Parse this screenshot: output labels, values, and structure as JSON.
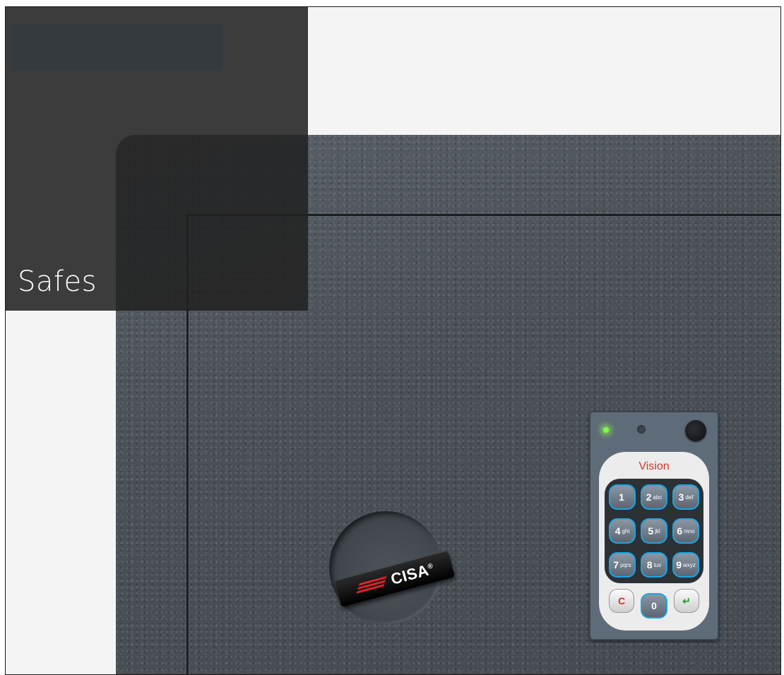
{
  "page": {
    "title": "Safes"
  },
  "handle": {
    "brand": "CISA",
    "registered_mark": "®",
    "logo_color": "#d8242a"
  },
  "keypad": {
    "brand": "Vision",
    "indicator_led": "green",
    "keys": [
      {
        "digit": "1",
        "letters": ""
      },
      {
        "digit": "2",
        "letters": "abc"
      },
      {
        "digit": "3",
        "letters": "def"
      },
      {
        "digit": "4",
        "letters": "ghi"
      },
      {
        "digit": "5",
        "letters": "jkl"
      },
      {
        "digit": "6",
        "letters": "mno"
      },
      {
        "digit": "7",
        "letters": "pqrs"
      },
      {
        "digit": "8",
        "letters": "tuv"
      },
      {
        "digit": "9",
        "letters": "wxyz"
      }
    ],
    "clear_label": "C",
    "zero_label": "0",
    "enter_symbol": "↵"
  },
  "colors": {
    "overlay": "#222222",
    "safe_body": "#4a5056",
    "key_border": "#1aa6e6",
    "brand_red": "#d5332c"
  }
}
